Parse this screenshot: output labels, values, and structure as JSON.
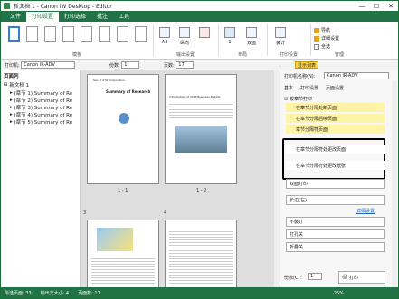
{
  "window": {
    "title": "新文档 1 - Canon iW Desktop - Editor",
    "min": "—",
    "max": "☐",
    "close": "✕"
  },
  "menu": [
    "文件",
    "打印设置",
    "打印选择",
    "批注",
    "工具"
  ],
  "ribbon": {
    "group_template": "模板",
    "group_output": "输出设置",
    "group_layout": "布局",
    "group_print": "打印设置",
    "group_arrange": "管理",
    "paper_size": "A4",
    "orientation_label": "纵向",
    "copies_label": "1",
    "duplex_label": "双面",
    "staple_label": "装订",
    "option1": "导航",
    "option2": "详细设置",
    "option_bottom": "全选"
  },
  "toolbar": {
    "printer_label": "打印机:",
    "printer_value": "Canon iR-ADV",
    "copies_label": "份数:",
    "copies_value": "1",
    "pages_label": "页数:",
    "pages_value": "17",
    "display_btn": "显示列表"
  },
  "left_pane": {
    "header": "页面列",
    "root": "新文档 1",
    "items": [
      "(章节 1) Summary of Re",
      "(章节 2) Summary of Re",
      "(章节 3) Summary of Re",
      "(章节 4) Summary of Re",
      "(章节 5) Summary of Re"
    ]
  },
  "pages": {
    "p1_label": "1 - 1",
    "p2_label": "1 - 2",
    "p3_label": "3",
    "p4_label": "4",
    "p1_title": "Summary of Research",
    "p1_header": "Sec. 1 XYZ Corporation",
    "p2_header": "Introduction of 2009 Business Details"
  },
  "right_pane": {
    "printer_label": "打印机名称(N):",
    "printer_value": "Canon iR-ADV",
    "tabs": [
      "基本",
      "打印设置",
      "页面设置"
    ],
    "section_label": "按章节打印",
    "options": [
      "在章节分隔处新页面",
      "在章节分隔后续页面",
      "章节分隔符页面"
    ],
    "hl_options": [
      "在章节分隔符处更改页面",
      "在章节分隔符处更改纸张"
    ],
    "duplex_value": "双面打印",
    "staple_value": "长边(左)",
    "link_text": "详细设置",
    "nostaple": "不装订",
    "punch": "打孔关",
    "layout": "折叠关",
    "copies_label": "份数(C):",
    "copies_value": "1",
    "print_btn": "打印"
  },
  "status": {
    "pages": "所选页面: 33",
    "size": "输出文大小: 4",
    "total": "页面数: 17",
    "zoom": "25%"
  }
}
